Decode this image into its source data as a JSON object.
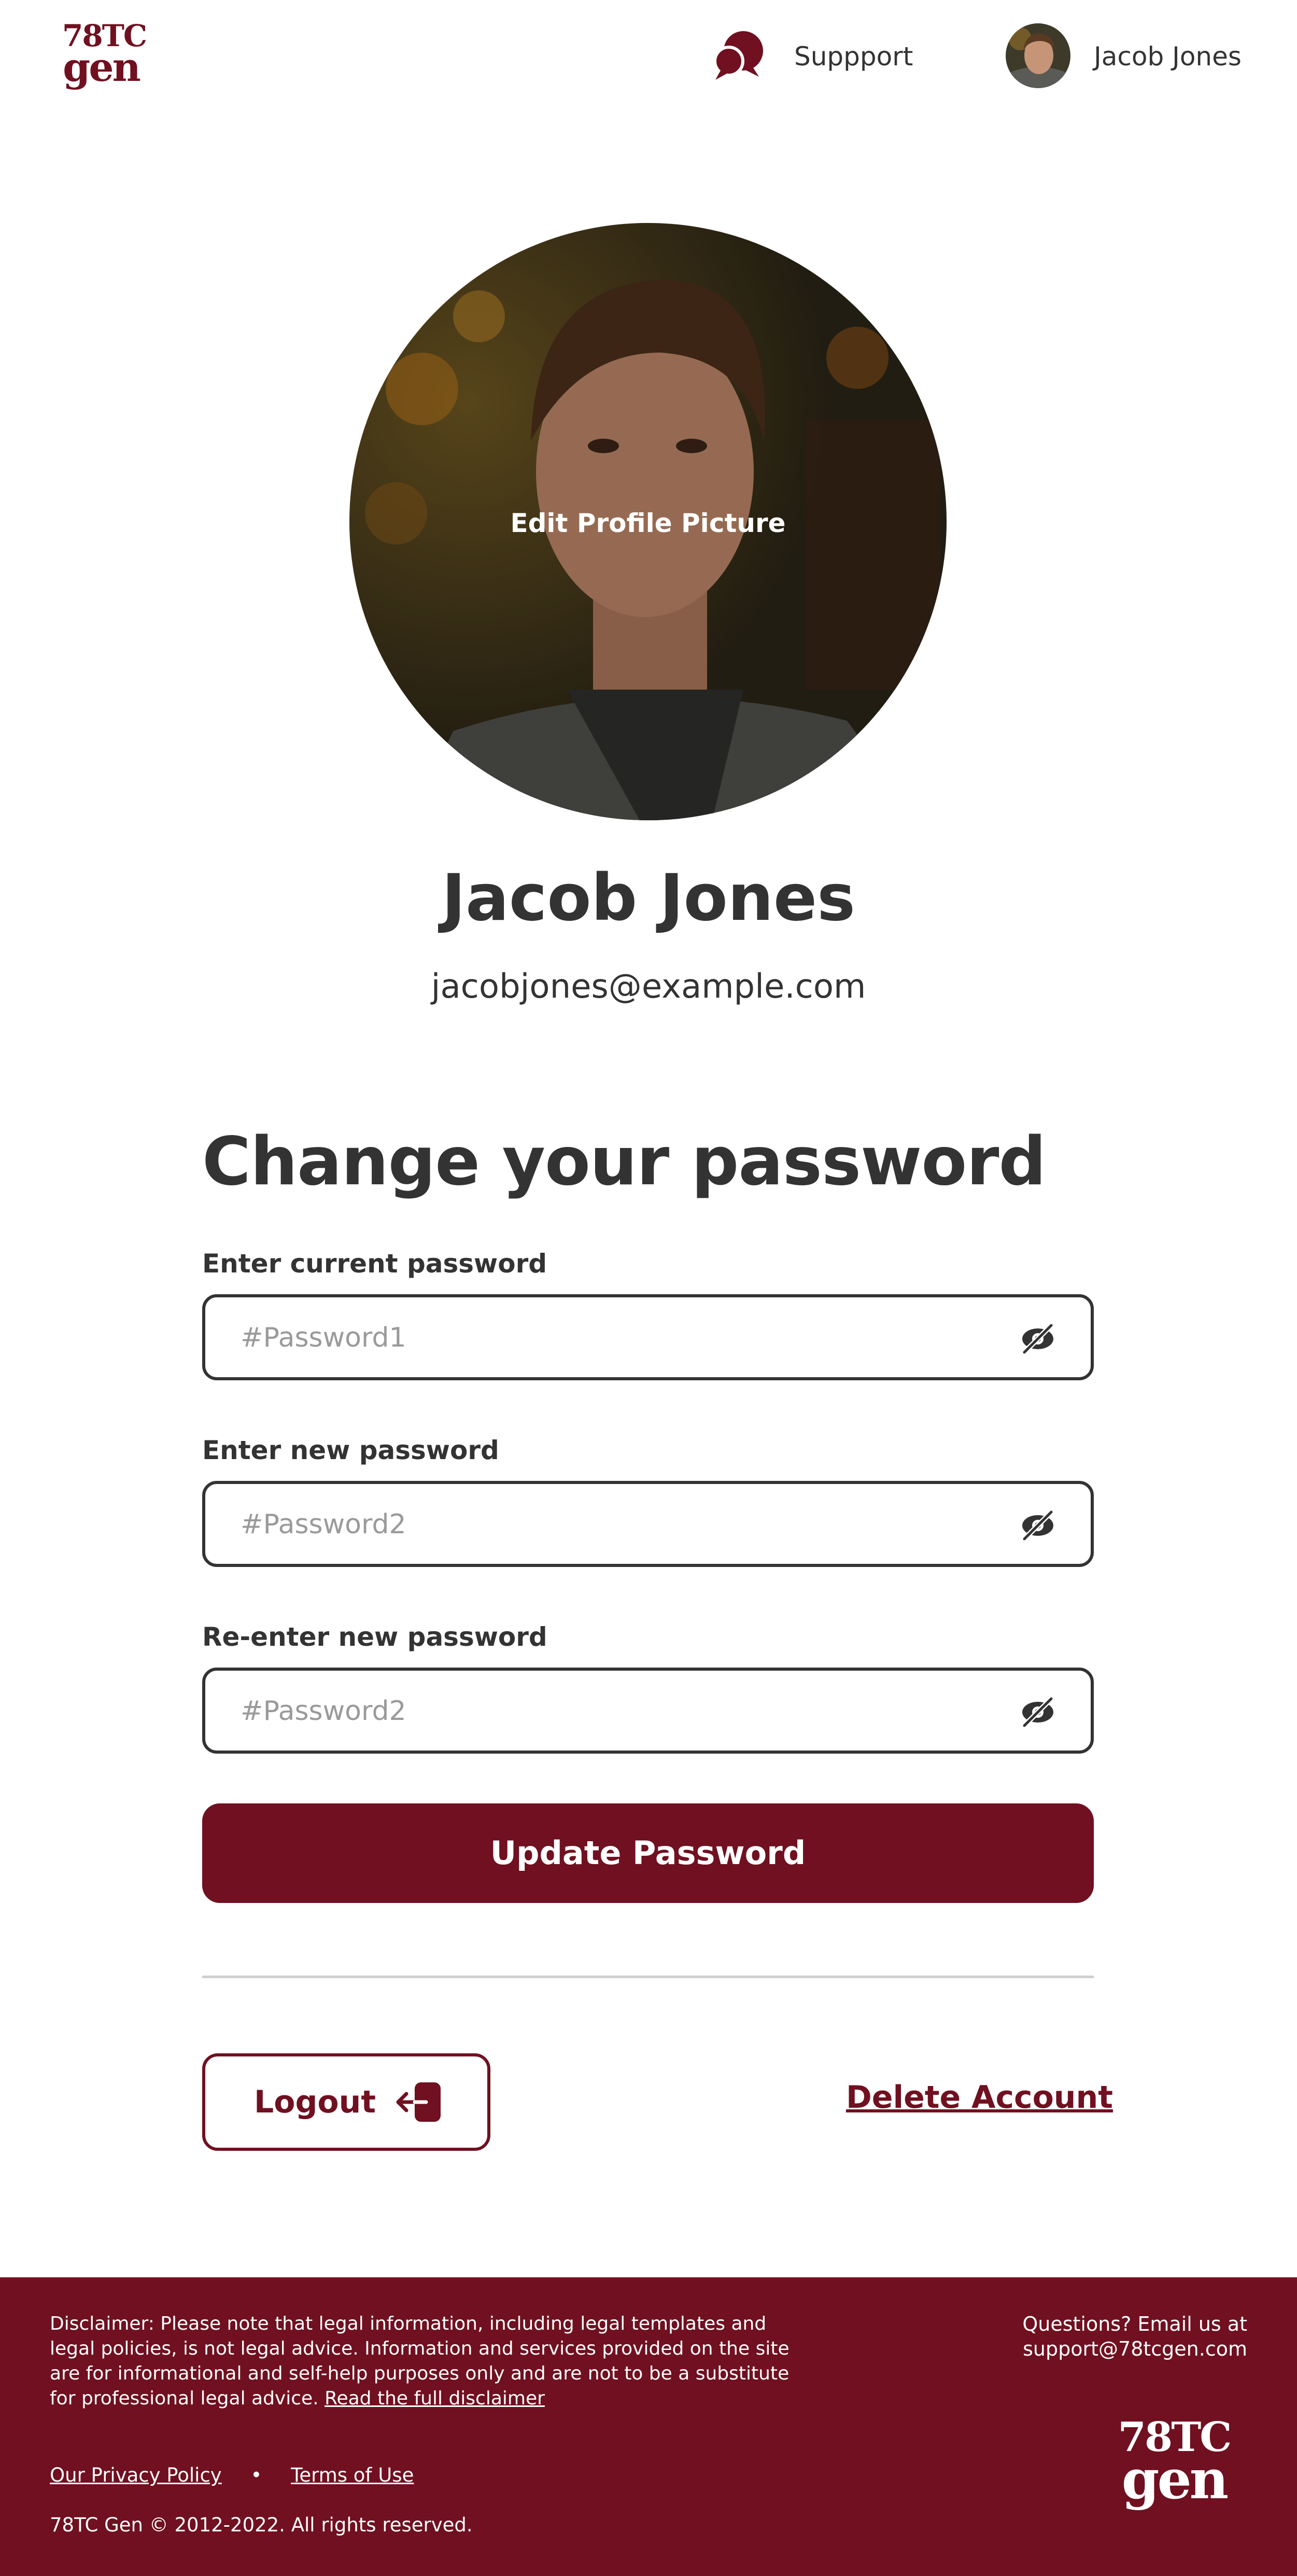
{
  "brand": {
    "logo_top": "78TC",
    "logo_bottom": "gen",
    "color": "#701020"
  },
  "header": {
    "support_label": "Suppport",
    "user_name": "Jacob Jones",
    "icons": {
      "support": "chat-bubbles-icon",
      "avatar": "user-avatar"
    }
  },
  "profile": {
    "edit_picture_label": "Edit Profile Picture",
    "name": "Jacob Jones",
    "email": "jacobjones@example.com"
  },
  "password_form": {
    "title": "Change your password",
    "fields": [
      {
        "label": "Enter current password",
        "placeholder": "#Password1",
        "icon": "eye-off-icon"
      },
      {
        "label": "Enter new password",
        "placeholder": "#Password2",
        "icon": "eye-off-icon"
      },
      {
        "label": "Re-enter new password",
        "placeholder": "#Password2",
        "icon": "eye-off-icon"
      }
    ],
    "submit_label": "Update Password"
  },
  "account_actions": {
    "logout_label": "Logout",
    "logout_icon": "logout-icon",
    "delete_label": "Delete Account"
  },
  "footer": {
    "disclaimer": "Disclaimer: Please note that legal information, including legal templates and legal policies, is not legal advice. Information and services provided on the site are for informational and self-help purposes only and are not to be a substitute for professional legal advice.",
    "disclaimer_link": "Read the full disclaimer",
    "questions_line1": "Questions? Email us at",
    "questions_email": "support@78tcgen.com",
    "privacy_link": "Our Privacy Policy",
    "separator": "•",
    "terms_link": "Terms of Use",
    "copyright": "78TC Gen © 2012-2022. All rights reserved."
  }
}
